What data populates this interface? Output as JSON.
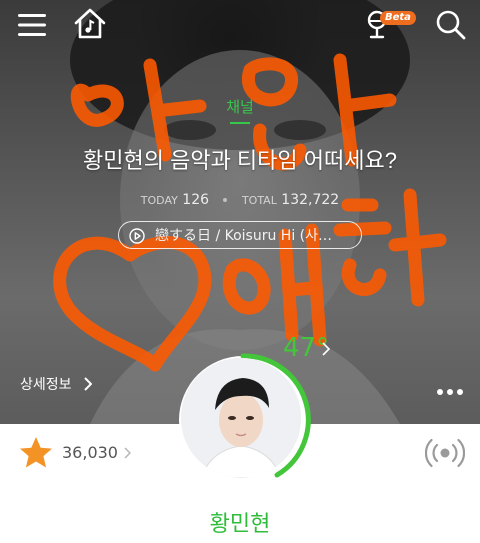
{
  "topbar": {
    "menu_icon": "hamburger-menu-icon",
    "home_icon": "music-home-icon",
    "mic_icon": "microphone-icon",
    "beta_label": "Beta",
    "search_icon": "search-icon"
  },
  "channel": {
    "category": "채널",
    "title": "황민현의 음악과 티타임 어떠세요?",
    "today_label": "TODAY",
    "today_value": "126",
    "total_label": "TOTAL",
    "total_value": "132,722",
    "now_playing": "戀する日 / Koisuru Hi (사…",
    "detail_label": "상세정보",
    "temperature": "47°",
    "handwriting": "민현 애해"
  },
  "stats_bar": {
    "like_count": "36,030"
  },
  "artist": {
    "name": "황민현"
  },
  "colors": {
    "accent_green": "#35c84a",
    "star_orange": "#f39325",
    "beta_orange": "#ef6d1e",
    "doodle_orange": "#ff5a00"
  }
}
